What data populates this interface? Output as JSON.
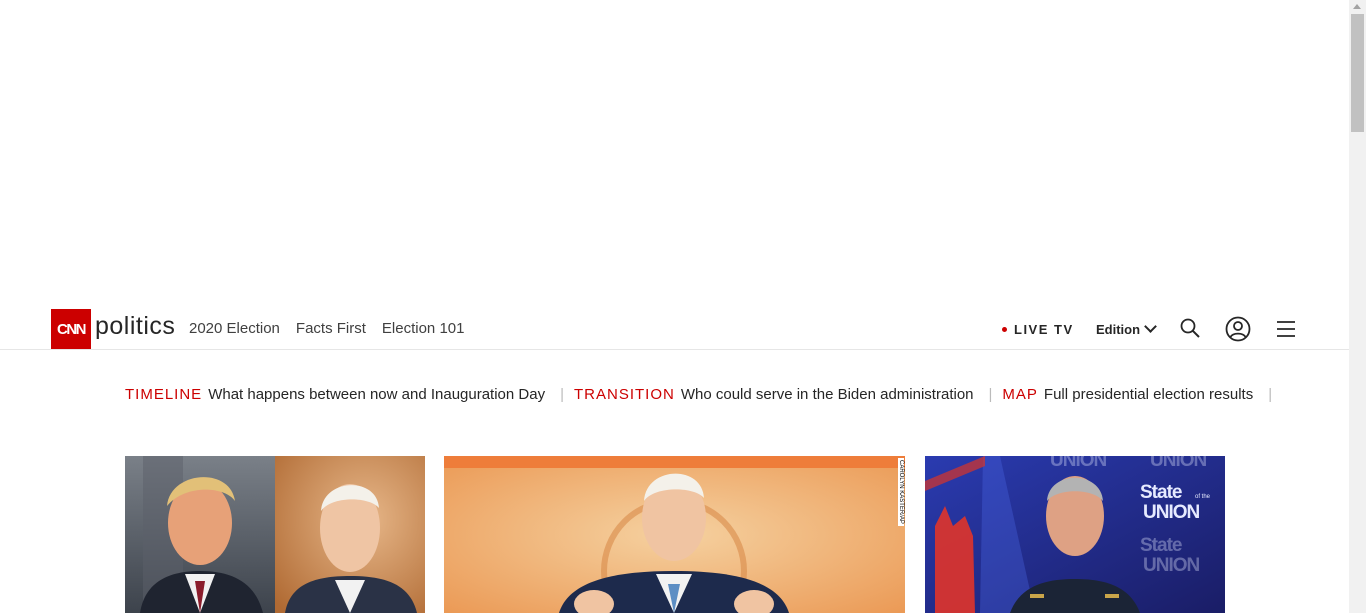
{
  "header": {
    "logo_text": "CNN",
    "section_name": "politics",
    "nav": [
      "2020 Election",
      "Facts First",
      "Election 101"
    ],
    "live_tv": "LIVE TV",
    "edition": "Edition",
    "icons": [
      "search-icon",
      "user-icon",
      "menu-icon",
      "chevron-down-icon"
    ]
  },
  "quicklinks": [
    {
      "kicker": "TIMELINE",
      "text": "What happens between now and Inauguration Day"
    },
    {
      "kicker": "TRANSITION",
      "text": "Who could serve in the Biden administration"
    },
    {
      "kicker": "MAP",
      "text": "Full presidential election results"
    }
  ],
  "cards": [
    {
      "image": "Trump and Biden side-by-side portraits"
    },
    {
      "image": "Biden speaking at podium",
      "credit": "CAROLYN KASTER/AP"
    },
    {
      "image": "State of the Union interview",
      "overlay_text": [
        "State",
        "of the",
        "UNION"
      ]
    }
  ],
  "colors": {
    "brand_red": "#cc0000",
    "text": "#262626",
    "separator": "#bbbbbb"
  }
}
